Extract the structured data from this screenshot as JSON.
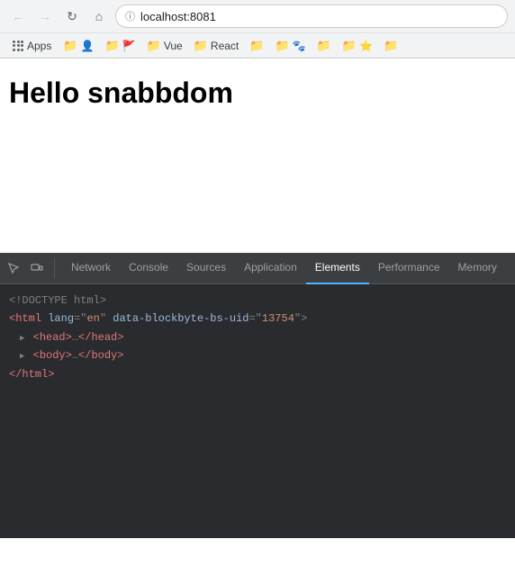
{
  "browser": {
    "url": "localhost:8081",
    "back_disabled": true,
    "forward_disabled": true,
    "reload_label": "↻"
  },
  "bookmarks_bar": {
    "apps_label": "Apps",
    "items": [
      {
        "id": "bm1",
        "label": ""
      },
      {
        "id": "bm2",
        "label": ""
      },
      {
        "id": "bm3",
        "label": "Vue"
      },
      {
        "id": "bm4",
        "label": "React"
      },
      {
        "id": "bm5",
        "label": ""
      },
      {
        "id": "bm6",
        "label": ""
      },
      {
        "id": "bm7",
        "label": ""
      },
      {
        "id": "bm8",
        "label": ""
      },
      {
        "id": "bm9",
        "label": ""
      },
      {
        "id": "bm10",
        "label": ""
      },
      {
        "id": "bm11",
        "label": ""
      }
    ]
  },
  "page": {
    "heading": "Hello snabbdom"
  },
  "devtools": {
    "tabs": [
      {
        "id": "network",
        "label": "Network",
        "active": false
      },
      {
        "id": "console",
        "label": "Console",
        "active": false
      },
      {
        "id": "sources",
        "label": "Sources",
        "active": false
      },
      {
        "id": "application",
        "label": "Application",
        "active": false
      },
      {
        "id": "elements",
        "label": "Elements",
        "active": true
      },
      {
        "id": "performance",
        "label": "Performance",
        "active": false
      },
      {
        "id": "memory",
        "label": "Memory",
        "active": false
      }
    ],
    "html_lines": [
      {
        "id": "line1",
        "content": "<!DOCTYPE html>"
      },
      {
        "id": "line2",
        "has_arrow": false,
        "raw": "<html lang=\"en\" data-blockbyte-bs-uid=\"13754\">"
      },
      {
        "id": "line3",
        "has_arrow": true,
        "raw": "<head>…</head>"
      },
      {
        "id": "line4",
        "has_arrow": true,
        "raw": "<body>…</body>"
      },
      {
        "id": "line5",
        "content": "</html>"
      }
    ]
  }
}
